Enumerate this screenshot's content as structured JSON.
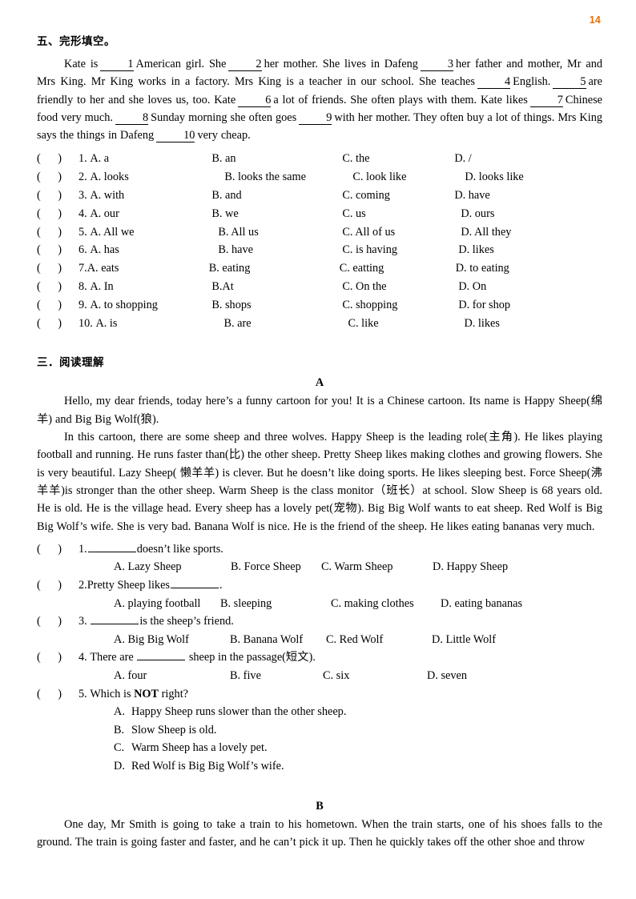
{
  "page": {
    "number": "14",
    "number_color": "#E8700A"
  },
  "cloze": {
    "heading": "五、完形填空。",
    "passage_parts": {
      "p1": "Kate is",
      "b1": "1",
      "p2": "American girl. She",
      "b2": "2",
      "p3": "her mother. She lives in Dafeng",
      "b3": "3",
      "p4": "her father and mother, Mr and Mrs King. Mr King works in a factory. Mrs King is a teacher in our school. She teaches",
      "b4": "4",
      "p5": "English.",
      "b5": "5",
      "p6": "are friendly to her and she loves us, too. Kate",
      "b6": "6",
      "p7": "a lot of friends. She often plays with them. Kate likes",
      "b7": "7",
      "p8": "Chinese food very much.",
      "b8": "8",
      "p9": "Sunday morning she often goes",
      "b9": "9",
      "p10": "with her mother. They often buy a lot of things. Mrs King says the things in Dafeng",
      "b10": "10",
      "p11": "very cheap."
    },
    "questions": [
      {
        "num": "1.",
        "a": "A. a",
        "b": "B. an",
        "c": "C. the",
        "d": "D. /"
      },
      {
        "num": "2.",
        "a": "A. looks",
        "b": "B. looks the same",
        "c": "C. look like",
        "d": "D. looks like"
      },
      {
        "num": "3.",
        "a": "A. with",
        "b": "B. and",
        "c": "C. coming",
        "d": "D. have"
      },
      {
        "num": "4.",
        "a": "A. our",
        "b": "B. we",
        "c": "C. us",
        "d": "D. ours"
      },
      {
        "num": "5.",
        "a": "A. All we",
        "b": "B. All us",
        "c": "C. All of us",
        "d": "D. All they"
      },
      {
        "num": "6.",
        "a": "A. has",
        "b": "B. have",
        "c": "C. is having",
        "d": "D. likes"
      },
      {
        "num": "7.",
        "a": "A. eats",
        "b": "B. eating",
        "c": "C. eatting",
        "d": "D. to eating"
      },
      {
        "num": "8.",
        "a": "A. In",
        "b": "B.At",
        "c": "C. On the",
        "d": "D. On"
      },
      {
        "num": "9.",
        "a": "A. to shopping",
        "b": "B. shops",
        "c": "C. shopping",
        "d": "D. for shop"
      },
      {
        "num": "10.",
        "a": "A. is",
        "b": "B. are",
        "c": "C. like",
        "d": "D. likes"
      }
    ]
  },
  "reading": {
    "heading": "三．阅读理解",
    "passage_a": {
      "label": "A",
      "para1": "Hello, my dear friends, today here’s a funny cartoon for you! It is a Chinese cartoon. Its name is Happy Sheep(绵羊) and Big Big Wolf(狼).",
      "para2": "In this cartoon, there are some sheep and three wolves. Happy Sheep is the leading role(主角). He likes playing football and running. He runs faster than(比) the other sheep. Pretty Sheep likes making clothes and growing flowers. She is very beautiful. Lazy Sheep( 懒羊羊) is clever. But he doesn’t like doing sports. He likes sleeping best. Force Sheep(沸羊羊)is stronger than the other sheep. Warm Sheep is the class monitor（班长）at school. Slow Sheep is 68 years old. He is old. He is the village head. Every sheep has a lovely pet(宠物). Big Big Wolf wants to eat sheep. Red Wolf is Big Big Wolf’s wife. She is very bad. Banana Wolf is nice. He is the friend of the sheep. He likes eating bananas very much."
    },
    "questions_a": [
      {
        "num": "1.",
        "stem_after": "doesn’t like sports.",
        "stem_before": "",
        "layout": "blank-first",
        "options": [
          "A. Lazy Sheep",
          "B. Force Sheep",
          "C. Warm Sheep",
          "D. Happy Sheep"
        ]
      },
      {
        "num": "2.",
        "stem_before": "Pretty Sheep likes",
        "stem_after": ".",
        "layout": "blank-mid",
        "options": [
          "A. playing football",
          "B. sleeping",
          "C. making clothes",
          "D. eating bananas"
        ]
      },
      {
        "num": "3.",
        "stem_before": "",
        "stem_after": "is the sheep’s friend.",
        "layout": "blank-first",
        "options": [
          "A. Big Big Wolf",
          "B. Banana Wolf",
          "C. Red Wolf",
          "D. Little Wolf"
        ]
      },
      {
        "num": "4.",
        "stem_before": "There are",
        "stem_after": "sheep in the passage(短文).",
        "layout": "blank-mid",
        "options": [
          "A. four",
          "B. five",
          "C. six",
          "D. seven"
        ]
      }
    ],
    "question5": {
      "num": "5.",
      "stem_pre": "Which is ",
      "stem_bold": "NOT",
      "stem_post": " right?",
      "options": [
        {
          "letter": "A.",
          "text": "Happy Sheep runs slower than the other sheep."
        },
        {
          "letter": "B.",
          "text": "Slow Sheep is old."
        },
        {
          "letter": "C.",
          "text": "Warm Sheep has a lovely pet."
        },
        {
          "letter": "D.",
          "text": "Red Wolf is Big Big Wolf’s wife."
        }
      ]
    },
    "passage_b": {
      "label": "B",
      "para1": "One day, Mr Smith is going to take a train to his hometown. When the train starts, one of his shoes falls to the ground. The train is going faster and faster, and he can’t pick it up. Then he quickly takes off the other shoe and throw"
    }
  }
}
